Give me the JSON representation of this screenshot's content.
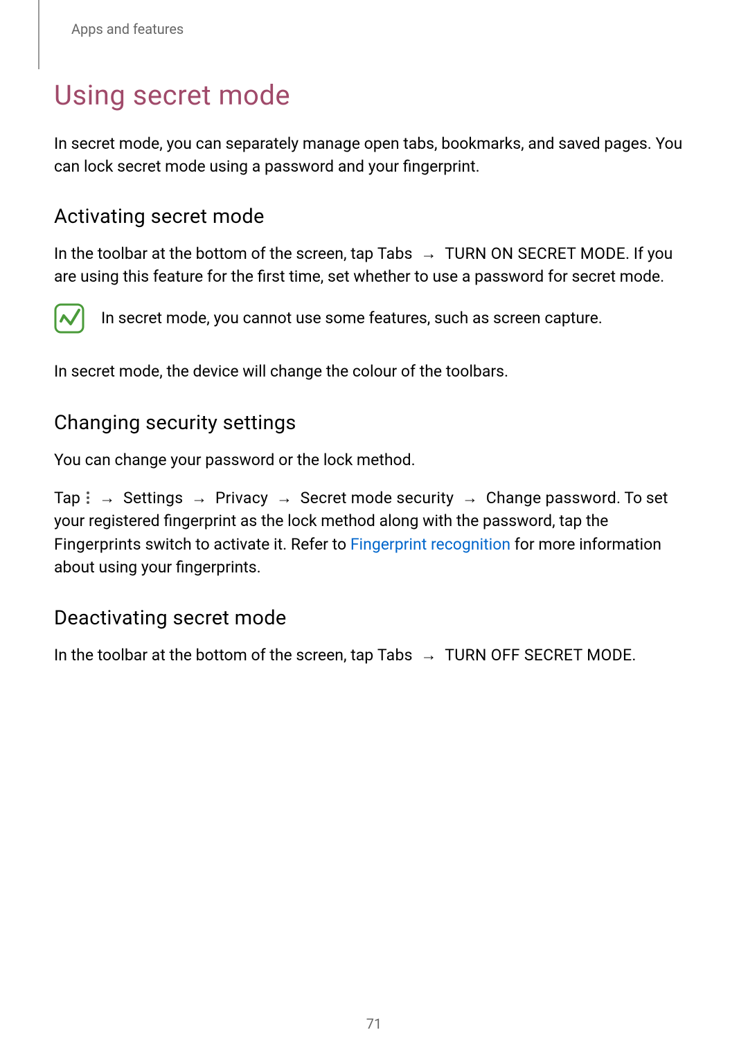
{
  "breadcrumb": "Apps and features",
  "h1": "Using secret mode",
  "intro": "In secret mode, you can separately manage open tabs, bookmarks, and saved pages. You can lock secret mode using a password and your fingerprint.",
  "activating": {
    "heading": "Activating secret mode",
    "p1_a": "In the toolbar at the bottom of the screen, tap ",
    "p1_tabs": "Tabs",
    "p1_arrow": " → ",
    "p1_turnon": "TURN ON SECRET MODE",
    "p1_b": ". If you are using this feature for the first time, set whether to use a password for secret mode.",
    "note": "In secret mode, you cannot use some features, such as screen capture.",
    "p2": "In secret mode, the device will change the colour of the toolbars."
  },
  "changing": {
    "heading": "Changing security settings",
    "p1": "You can change your password or the lock method.",
    "p2_a": "Tap ",
    "p2_arrow1": " → ",
    "p2_settings": "Settings",
    "p2_arrow2": " → ",
    "p2_privacy": "Privacy",
    "p2_arrow3": " → ",
    "p2_secret": "Secret mode security",
    "p2_arrow4": " → ",
    "p2_change": "Change password",
    "p2_b": ". To set your registered fingerprint as the lock method along with the password, tap the ",
    "p2_fingerprints": "Fingerprints",
    "p2_c": " switch to activate it. Refer to ",
    "p2_link": "Fingerprint recognition",
    "p2_d": " for more information about using your fingerprints."
  },
  "deactivating": {
    "heading": "Deactivating secret mode",
    "p1_a": "In the toolbar at the bottom of the screen, tap ",
    "p1_tabs": "Tabs",
    "p1_arrow": " → ",
    "p1_turnoff": "TURN OFF SECRET MODE",
    "p1_b": "."
  },
  "page_number": "71"
}
